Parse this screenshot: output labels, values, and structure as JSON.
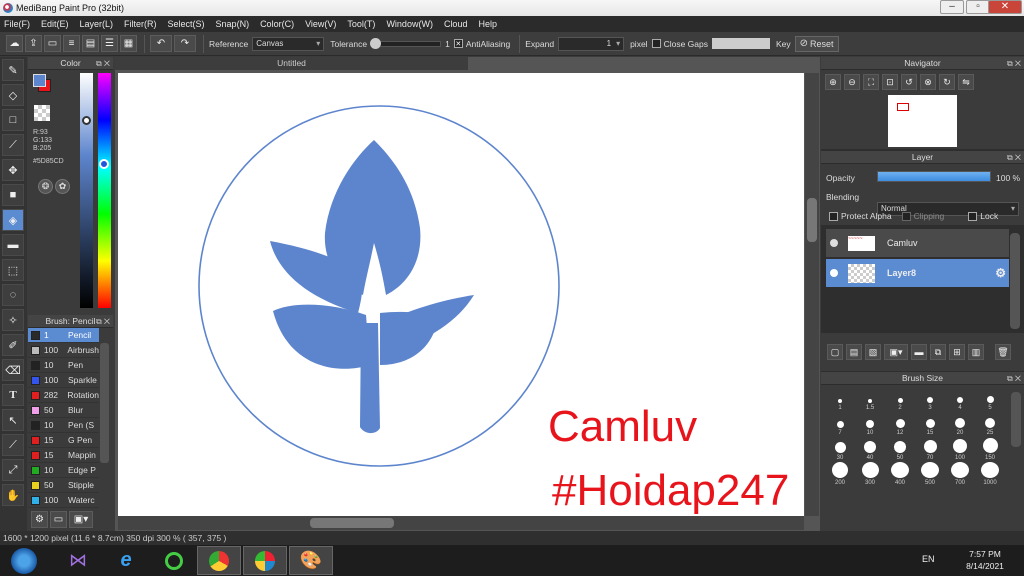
{
  "window": {
    "title": "MediBang Paint Pro (32bit)"
  },
  "menu": [
    "File(F)",
    "Edit(E)",
    "Layer(L)",
    "Filter(R)",
    "Select(S)",
    "Snap(N)",
    "Color(C)",
    "View(V)",
    "Tool(T)",
    "Window(W)",
    "Cloud",
    "Help"
  ],
  "toolbar": {
    "reference_label": "Reference",
    "reference_value": "Canvas",
    "tolerance_label": "Tolerance",
    "tolerance_value": "1",
    "antialiasing_label": "AntiAliasing",
    "expand_label": "Expand",
    "expand_value": "1",
    "expand_unit": "pixel",
    "close_gaps_label": "Close Gaps",
    "key_label": "Key",
    "reset_label": "Reset"
  },
  "color_panel": {
    "title": "Color",
    "r": "R:93",
    "g": "G:133",
    "b": "B:205",
    "hex": "#5D85CD",
    "primary_color": "#5d85cd",
    "secondary_color": "#e8141c"
  },
  "brush_panel": {
    "title": "Brush: Pencil",
    "items": [
      {
        "size": "1",
        "name": "Pencil",
        "color": "#2a2a2a",
        "selected": true
      },
      {
        "size": "100",
        "name": "Airbrush",
        "color": "#bbbbbb"
      },
      {
        "size": "10",
        "name": "Pen",
        "color": "#222222"
      },
      {
        "size": "100",
        "name": "Sparkle",
        "color": "#3355ee"
      },
      {
        "size": "282",
        "name": "Rotation",
        "color": "#e02020"
      },
      {
        "size": "50",
        "name": "Blur",
        "color": "#f0a0e8"
      },
      {
        "size": "10",
        "name": "Pen (S",
        "color": "#222222"
      },
      {
        "size": "15",
        "name": "G Pen",
        "color": "#e02020"
      },
      {
        "size": "15",
        "name": "Mappin",
        "color": "#e02020"
      },
      {
        "size": "10",
        "name": "Edge P",
        "color": "#22aa22"
      },
      {
        "size": "50",
        "name": "Stipple",
        "color": "#e8d020"
      },
      {
        "size": "100",
        "name": "Waterc",
        "color": "#30b0e8"
      }
    ]
  },
  "document": {
    "tab_title": "Untitled",
    "text1": "Camluv",
    "text2": "#Hoidap247",
    "leaf_color": "#5d85cd",
    "text_color": "#e8141c"
  },
  "navigator": {
    "title": "Navigator"
  },
  "layer_panel": {
    "title": "Layer",
    "opacity_label": "Opacity",
    "opacity_value": "100 %",
    "opacity_fraction": 1.0,
    "blending_label": "Blending",
    "blending_value": "Normal",
    "protect_alpha": "Protect Alpha",
    "clipping": "Clipping",
    "lock": "Lock",
    "layers": [
      {
        "name": "Camluv",
        "selected": false
      },
      {
        "name": "Layer8",
        "selected": true
      }
    ]
  },
  "brush_size_panel": {
    "title": "Brush Size",
    "sizes": [
      "1",
      "1.5",
      "2",
      "3",
      "4",
      "5",
      "7",
      "10",
      "12",
      "15",
      "20",
      "25",
      "30",
      "40",
      "50",
      "70",
      "100",
      "150",
      "200",
      "300",
      "400",
      "500",
      "700",
      "1000"
    ]
  },
  "status": {
    "text": "1600 * 1200 pixel  (11.6 * 8.7cm)  350 dpi  300 %  ( 357, 375 )"
  },
  "taskbar": {
    "language": "EN",
    "time": "7:57 PM",
    "date": "8/14/2021"
  }
}
